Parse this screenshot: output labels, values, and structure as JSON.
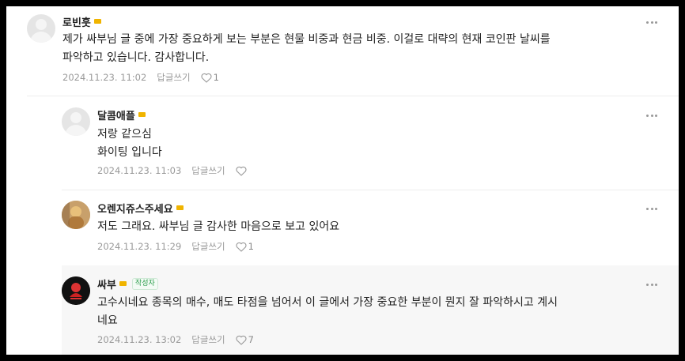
{
  "comments": [
    {
      "author": "로빈훗",
      "text": "제가 싸부님 글 중에 가장 중요하게 보는 부분은 현물 비중과 현금 비중. 이걸로 대략의 현재 코인판 날씨를\n파악하고 있습니다. 감사합니다.",
      "date": "2024.11.23. 11:02",
      "reply_label": "답글쓰기",
      "likes": "1"
    },
    {
      "author": "달콤애플",
      "text": "저랑 같으심\n화이팅 입니다",
      "date": "2024.11.23. 11:03",
      "reply_label": "답글쓰기",
      "likes": ""
    },
    {
      "author": "오렌지쥬스주세요",
      "text": "저도 그래요. 싸부님 글 감사한 마음으로 보고 있어요",
      "date": "2024.11.23. 11:29",
      "reply_label": "답글쓰기",
      "likes": "1"
    },
    {
      "author": "싸부",
      "author_tag": "작성자",
      "text": "고수시네요 종목의 매수, 매도 타점을 넘어서 이 글에서 가장 중요한 부분이 뭔지 잘 파악하시고 계시\n네요",
      "date": "2024.11.23. 13:02",
      "reply_label": "답글쓰기",
      "likes": "7"
    }
  ],
  "icons": {
    "more": "more-options-icon",
    "heart": "heart-icon",
    "badge": "level-badge-icon"
  },
  "colors": {
    "author_tag": "#2a9d4b",
    "badge": "#f0b400",
    "highlight_bg": "#f7f7f7"
  }
}
